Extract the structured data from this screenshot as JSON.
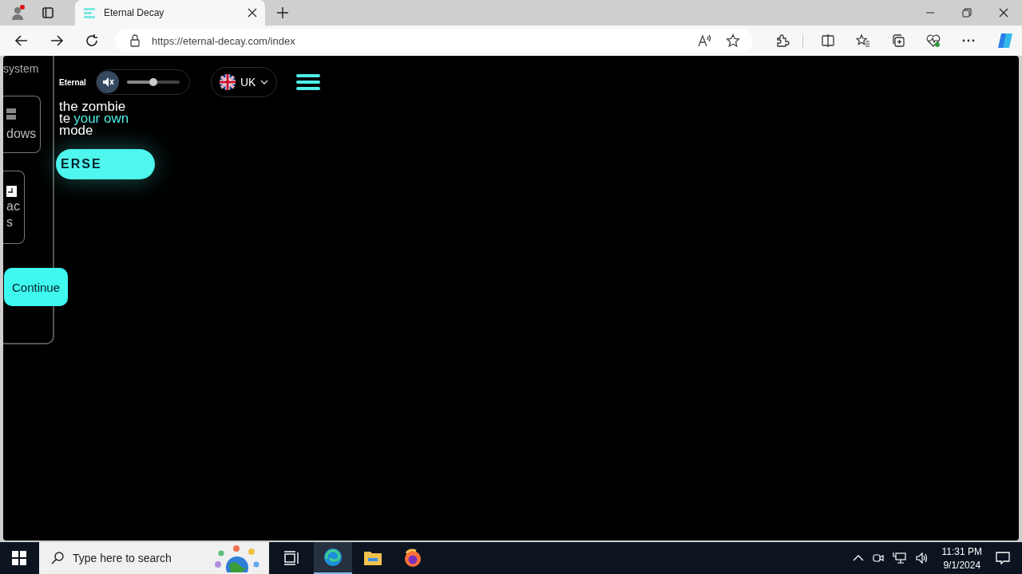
{
  "browser": {
    "tabs": [
      {
        "title": "Eternal Decay",
        "selected": true
      }
    ],
    "url": "https://eternal-decay.com/index"
  },
  "page": {
    "sidebar_label": "system",
    "platforms": [
      {
        "kind": "windows",
        "lines": [
          "dows"
        ]
      },
      {
        "kind": "mac",
        "lines": [
          "ac",
          "s"
        ]
      }
    ],
    "continue_button": "Continue",
    "logo": "Eternal",
    "volume": {
      "muted": true,
      "level": 0.5
    },
    "language": "UK",
    "hero_lines": [
      [
        {
          "text": "the zombie",
          "accent": false
        }
      ],
      [
        {
          "text": "te",
          "accent": false
        },
        {
          "text": "your own",
          "accent": true
        }
      ],
      [
        {
          "text": "mode",
          "accent": false
        }
      ]
    ],
    "cta": "ERSE"
  },
  "taskbar": {
    "search_placeholder": "Type here to search",
    "time": "11:31 PM",
    "date": "9/1/2024"
  }
}
